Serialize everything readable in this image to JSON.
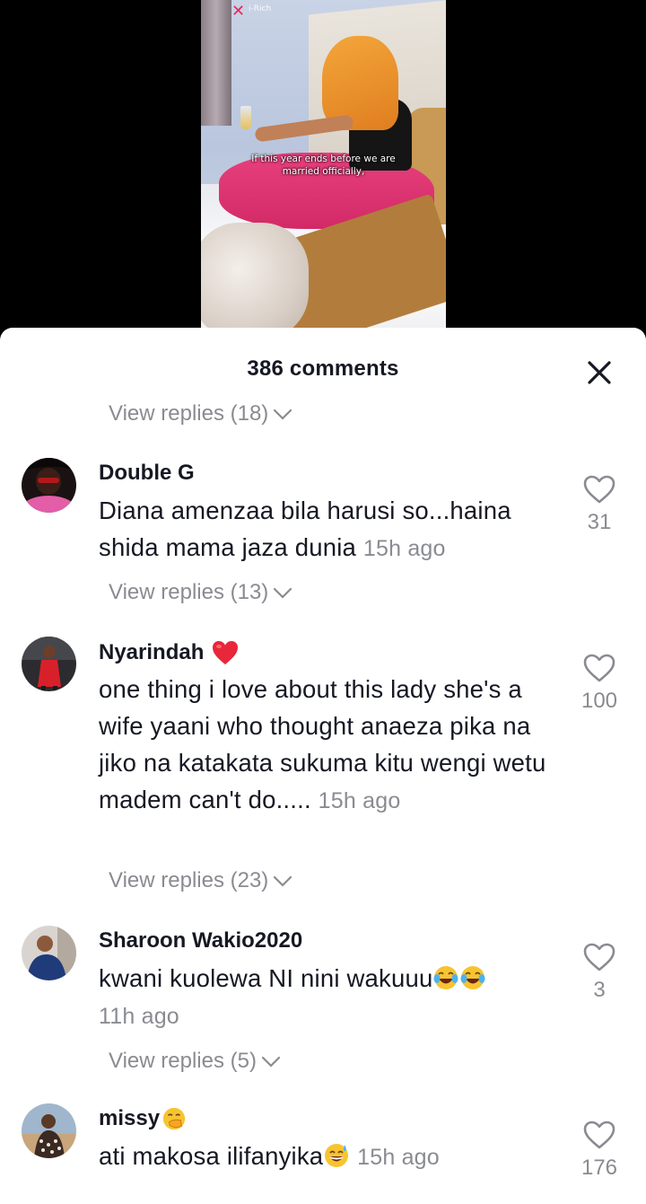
{
  "video": {
    "logo_text": "i-Rich",
    "caption_line1": "If this year ends before we are",
    "caption_line2": "married officially,"
  },
  "sheet": {
    "title": "386 comments"
  },
  "top_replies": {
    "label": "View replies (18)"
  },
  "comments": [
    {
      "username": "Double G",
      "text": "Diana amenzaa bila harusi so...haina shida mama jaza dunia",
      "time": "15h ago",
      "likes": "31",
      "replies": "View replies (13)"
    },
    {
      "username": "Nyarindah",
      "username_emoji": "red-heart",
      "text": "one thing i love about this lady she's a wife yaani who thought anaeza pika na jiko na katakata sukuma kitu wengi wetu madem can't do.....",
      "time": "15h ago",
      "likes": "100",
      "replies": "View replies (23)"
    },
    {
      "username": "Sharoon Wakio2020",
      "text": "kwani kuolewa NI nini wakuuu",
      "text_emoji": "tears-of-joy x2",
      "time": "11h ago",
      "likes": "3",
      "replies": "View replies (5)"
    },
    {
      "username": "missy",
      "username_emoji": "hand-over-mouth",
      "text": "ati makosa ilifanyika",
      "text_emoji": "grinning-sweat",
      "time": "15h ago",
      "likes": "176"
    }
  ],
  "colors": {
    "primary_text": "#161823",
    "secondary_text": "#8a8b91",
    "heart_emoji": "#e8273b"
  }
}
